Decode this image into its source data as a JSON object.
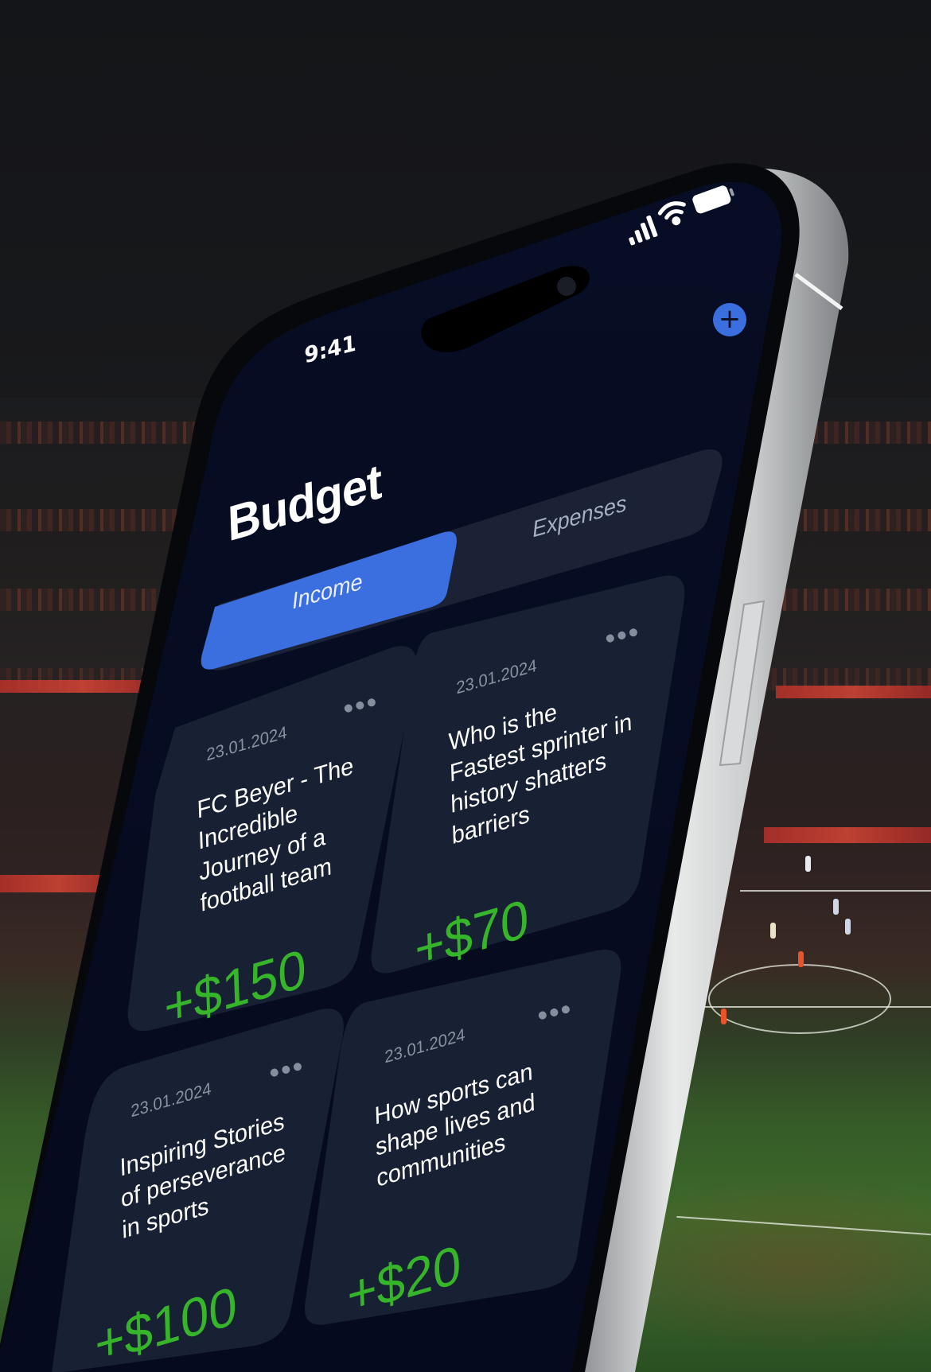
{
  "status_bar": {
    "time": "9:41"
  },
  "header": {
    "title": "Budget",
    "add_label": "+"
  },
  "tabs": [
    {
      "label": "Income",
      "active": true
    },
    {
      "label": "Expenses",
      "active": false
    }
  ],
  "cards": [
    {
      "date": "23.01.2024",
      "title_lines": [
        "FC Beyer - The",
        "Incredible",
        "Journey of a",
        "football team"
      ],
      "amount": "+$150"
    },
    {
      "date": "23.01.2024",
      "title_lines": [
        "Who is the",
        "Fastest sprinter in",
        "history shatters",
        "barriers"
      ],
      "amount": "+$70"
    },
    {
      "date": "23.01.2024",
      "title_lines": [
        "Inspiring Stories",
        "of perseverance",
        "in sports"
      ],
      "amount": "+$100"
    },
    {
      "date": "23.01.2024",
      "title_lines": [
        "How sports can",
        "shape lives and",
        "communities"
      ],
      "amount": "+$20"
    }
  ],
  "colors": {
    "screen_bg": "#060d24",
    "card_bg": "#182034",
    "accent": "#3b6fe0",
    "amount": "#37b52a"
  }
}
